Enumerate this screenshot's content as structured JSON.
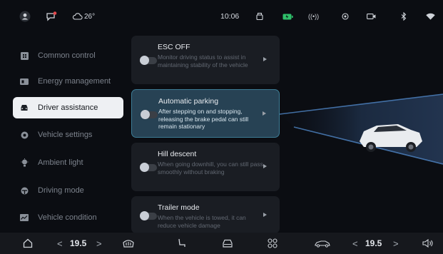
{
  "status_bar": {
    "weather_temp": "26°",
    "time": "10:06",
    "icons": [
      "profile-icon",
      "message-badge-icon",
      "cloud-icon",
      "cup-icon",
      "battery-icon",
      "signal-wave-icon",
      "location-icon",
      "camera-icon",
      "bluetooth-icon",
      "wifi-icon"
    ]
  },
  "sidebar": {
    "items": [
      {
        "label": "Common control",
        "icon": "grid-icon",
        "active": false
      },
      {
        "label": "Energy management",
        "icon": "battery-icon",
        "active": false
      },
      {
        "label": "Driver assistance",
        "icon": "car-front-icon",
        "active": true
      },
      {
        "label": "Vehicle settings",
        "icon": "gear-icon",
        "active": false
      },
      {
        "label": "Ambient light",
        "icon": "bulb-icon",
        "active": false
      },
      {
        "label": "Driving mode",
        "icon": "steering-icon",
        "active": false
      },
      {
        "label": "Vehicle condition",
        "icon": "chart-icon",
        "active": false
      }
    ]
  },
  "cards": [
    {
      "title": "ESC OFF",
      "desc": "Monitor driving status to assist in maintaining stability of the vehicle",
      "active": false,
      "toggle_on": false
    },
    {
      "title": "Automatic parking",
      "desc": "After stepping on and stopping, releasing the brake pedal can still remain stationary",
      "active": true,
      "toggle_on": false
    },
    {
      "title": "Hill descent",
      "desc": "When going downhill, you can still pass smoothly without braking",
      "active": false,
      "toggle_on": false
    },
    {
      "title": "Trailer mode",
      "desc": "When the vehicle is towed, it can reduce vehicle damage",
      "active": false,
      "toggle_on": false
    }
  ],
  "bottom_bar": {
    "left_temp": "19.5",
    "right_temp": "19.5",
    "icons": [
      "home-icon",
      "rear-defrost-icon",
      "seat-icon",
      "car-icon",
      "apps-icon",
      "car-side-icon",
      "volume-icon"
    ]
  },
  "colors": {
    "accent": "#3d7d96",
    "active_card": "#274254",
    "active_nav": "#eef0f3",
    "background": "#0b0d12"
  }
}
